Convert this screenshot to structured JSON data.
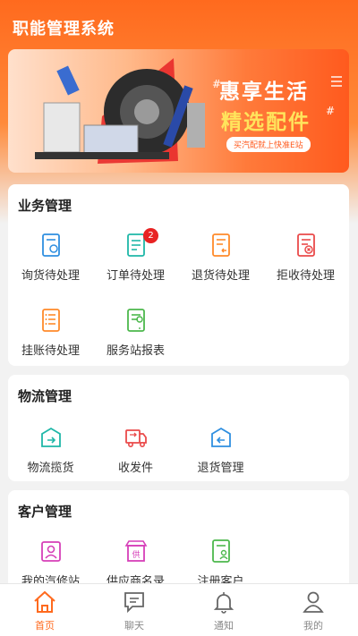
{
  "app": {
    "title": "职能管理系统"
  },
  "banner": {
    "headline": "惠享生活",
    "subline": "精选配件",
    "tagline": "买汽配就上快准E站"
  },
  "sections": [
    {
      "title": "业务管理",
      "items": [
        {
          "label": "询货待处理",
          "icon": "inquiry-doc-icon"
        },
        {
          "label": "订单待处理",
          "icon": "order-doc-icon",
          "badge": "2"
        },
        {
          "label": "退货待处理",
          "icon": "return-doc-icon"
        },
        {
          "label": "拒收待处理",
          "icon": "reject-doc-icon"
        },
        {
          "label": "挂账待处理",
          "icon": "credit-list-icon"
        },
        {
          "label": "服务站报表",
          "icon": "station-report-icon"
        }
      ]
    },
    {
      "title": "物流管理",
      "items": [
        {
          "label": "物流揽货",
          "icon": "pickup-box-icon"
        },
        {
          "label": "收发件",
          "icon": "delivery-truck-icon"
        },
        {
          "label": "退货管理",
          "icon": "return-box-icon"
        }
      ]
    },
    {
      "title": "客户管理",
      "items": [
        {
          "label": "我的汽修站",
          "icon": "repair-station-icon"
        },
        {
          "label": "供应商名录",
          "icon": "supplier-store-icon"
        },
        {
          "label": "注册客户",
          "icon": "register-customer-icon"
        }
      ]
    }
  ],
  "tabs": [
    {
      "label": "首页",
      "icon": "home-icon",
      "active": true
    },
    {
      "label": "聊天",
      "icon": "chat-icon"
    },
    {
      "label": "通知",
      "icon": "bell-icon"
    },
    {
      "label": "我的",
      "icon": "profile-icon"
    }
  ],
  "colors": {
    "brand": "#ff6a1e",
    "blue": "#2f8fe0",
    "teal": "#1fb7a8",
    "orange": "#ff8a2a",
    "red": "#ea4a4a",
    "green": "#4cb84c",
    "pink": "#d63fb8"
  }
}
